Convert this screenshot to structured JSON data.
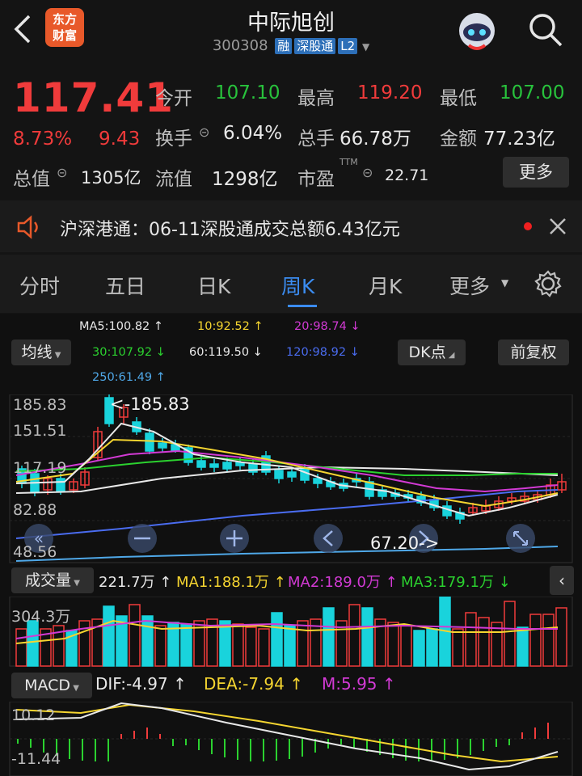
{
  "header": {
    "back_icon": "chevron-left-icon",
    "logo_text": [
      "东方",
      "财富"
    ],
    "stock_name": "中际旭创",
    "stock_code": "300308",
    "tags": [
      "融",
      "深股通",
      "L2"
    ],
    "robot_icon": "robot-avatar-icon",
    "search_icon": "search-icon"
  },
  "quote": {
    "price": "117.41",
    "change_pct": "8.73%",
    "change_abs": "9.43",
    "fields": [
      {
        "label": "今开",
        "value": "107.10",
        "color": "green"
      },
      {
        "label": "最高",
        "value": "119.20",
        "color": "red"
      },
      {
        "label": "最低",
        "value": "107.00",
        "color": "green"
      },
      {
        "label": "换手",
        "value": "6.04%",
        "color": "white"
      },
      {
        "label": "总手",
        "value": "66.78万",
        "color": "white"
      },
      {
        "label": "金额",
        "value": "77.23亿",
        "color": "white"
      },
      {
        "label": "总值",
        "value": "1305亿",
        "color": "white"
      },
      {
        "label": "流值",
        "value": "1298亿",
        "color": "white"
      },
      {
        "label": "市盈",
        "value": "22.71",
        "color": "white"
      }
    ],
    "ttm": "TTM",
    "more_button": "更多"
  },
  "announcement": {
    "text": "沪深港通：06-11深股通成交总额6.43亿元"
  },
  "tabs": [
    "分时",
    "五日",
    "日K",
    "周K",
    "月K",
    "更多"
  ],
  "active_tab": "周K",
  "ma_legend": {
    "ma5": "MA5:100.82 ↑",
    "ma10": "10:92.52 ↑",
    "ma20": "20:98.74 ↓",
    "ma30": "30:107.92 ↓",
    "ma60": "60:119.50 ↓",
    "ma120": "120:98.92 ↓",
    "ma250": "250:61.49 ↑"
  },
  "controls": {
    "avg_line": "均线",
    "dk_point": "DK点",
    "restore": "前复权"
  },
  "price_axis": [
    "185.83",
    "151.51",
    "117.19",
    "82.88",
    "48.56"
  ],
  "price_annotations": {
    "high": "185.83",
    "low": "67.20"
  },
  "volume": {
    "label": "成交量",
    "value": "221.7万 ↑",
    "ma1": "MA1:188.1万 ↑",
    "ma2": "MA2:189.0万 ↑",
    "ma3": "MA3:179.1万 ↓",
    "axis_top": "304.3万"
  },
  "macd": {
    "label": "MACD",
    "dif": "DIF:-4.97 ↑",
    "dea": "DEA:-7.94 ↑",
    "m": "M:5.95 ↑",
    "axis_top": "10.12",
    "axis_bottom": "-11.44"
  },
  "colors": {
    "up": "#f03b3b",
    "down": "#19d3dc",
    "ma5": "#e8e8e8",
    "ma10": "#f5d530",
    "ma20": "#d23ad4",
    "ma30": "#2bd12f",
    "ma60": "#e8e8e8",
    "ma120": "#4a6cf0",
    "ma250": "#4fa8e8"
  }
}
